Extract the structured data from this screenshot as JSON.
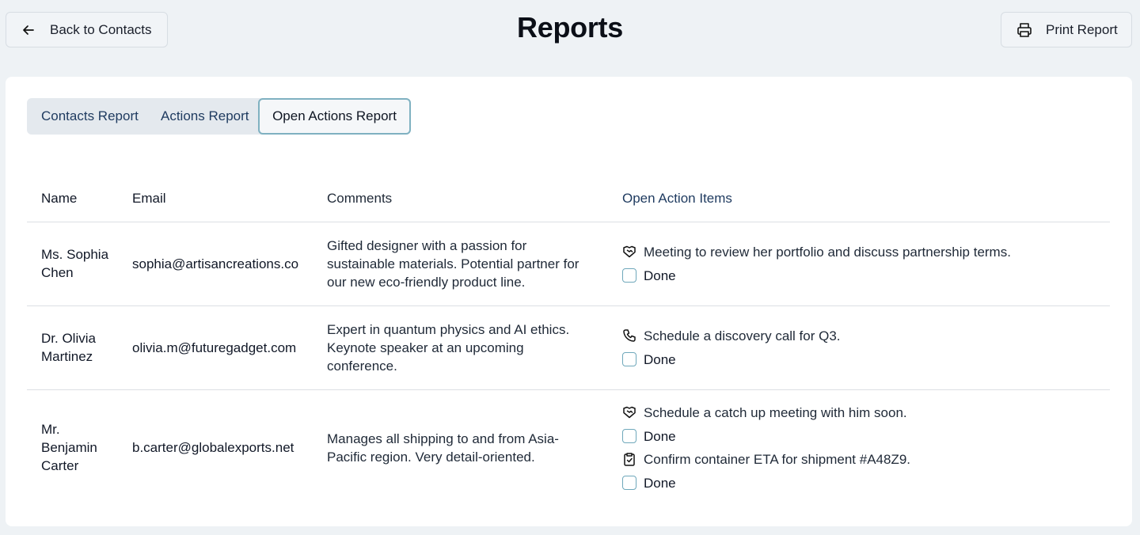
{
  "header": {
    "back_label": "Back to Contacts",
    "title": "Reports",
    "print_label": "Print Report"
  },
  "tabs": [
    {
      "label": "Contacts Report"
    },
    {
      "label": "Actions Report"
    },
    {
      "label": "Open Actions Report",
      "active": true
    }
  ],
  "table": {
    "columns": [
      "Name",
      "Email",
      "Comments",
      "Open Action Items"
    ],
    "rows": [
      {
        "name": "Ms. Sophia Chen",
        "email": "sophia@artisancreations.co",
        "comments": "Gifted designer with a passion for sustainable materials. Potential partner for our new eco-friendly product line.",
        "actions": [
          {
            "icon": "handshake-icon",
            "text": "Meeting to review her portfolio and discuss partnership terms.",
            "done_label": "Done"
          }
        ]
      },
      {
        "name": "Dr. Olivia Martinez",
        "email": "olivia.m@futuregadget.com",
        "comments": "Expert in quantum physics and AI ethics. Keynote speaker at an upcoming conference.",
        "actions": [
          {
            "icon": "phone-icon",
            "text": "Schedule a discovery call for Q3.",
            "done_label": "Done"
          }
        ]
      },
      {
        "name": "Mr. Benjamin Carter",
        "email": "b.carter@globalexports.net",
        "comments": "Manages all shipping to and from Asia-Pacific region. Very detail-oriented.",
        "actions": [
          {
            "icon": "handshake-icon",
            "text": "Schedule a catch up meeting with him soon.",
            "done_label": "Done"
          },
          {
            "icon": "clipboard-check-icon",
            "text": "Confirm container ETA for shipment #A48Z9.",
            "done_label": "Done"
          }
        ]
      }
    ]
  },
  "colors": {
    "background": "#eef2f5",
    "accent": "#7fb1c1",
    "header_text": "#1e3a5f"
  }
}
